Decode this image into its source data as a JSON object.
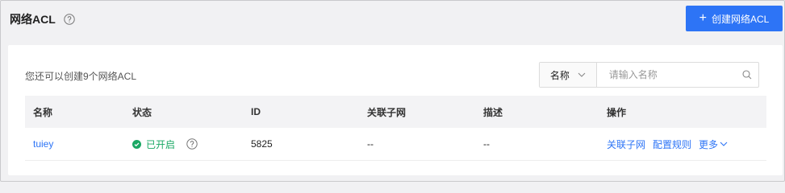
{
  "page": {
    "title": "网络ACL",
    "create_button": "创建网络ACL"
  },
  "toolbar": {
    "quota_text": "您还可以创建9个网络ACL",
    "search_field": "名称",
    "search_placeholder": "请输入名称"
  },
  "table": {
    "headers": [
      "名称",
      "状态",
      "ID",
      "关联子网",
      "描述",
      "操作"
    ],
    "rows": [
      {
        "name": "tuiey",
        "status": "已开启",
        "id": "5825",
        "subnets": "--",
        "description": "--",
        "actions": [
          "关联子网",
          "配置规则",
          "更多"
        ]
      }
    ]
  },
  "colors": {
    "primary": "#2d74f6",
    "success": "#1aa864"
  }
}
